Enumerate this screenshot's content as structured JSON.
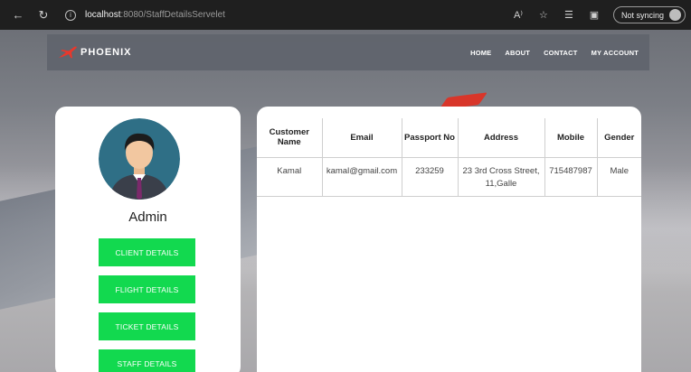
{
  "browser": {
    "url_host": "localhost",
    "url_path": ":8080/StaffDetailsServelet",
    "sync_label": "Not syncing",
    "read_aloud_icon": "A⁾"
  },
  "site": {
    "brand": "PHOENIX",
    "menu": [
      "HOME",
      "ABOUT",
      "CONTACT",
      "MY ACCOUNT"
    ]
  },
  "profile": {
    "role": "Admin",
    "buttons": [
      "CLIENT DETAILS",
      "FLIGHT DETAILS",
      "TICKET DETAILS",
      "STAFF DETAILS"
    ]
  },
  "table": {
    "headers": {
      "customer_name": "Customer Name",
      "email": "Email",
      "passport": "Passport No",
      "address": "Address",
      "mobile": "Mobile",
      "gender": "Gender"
    },
    "rows": [
      {
        "customer_name": "Kamal",
        "email": "kamal@gmail.com",
        "passport": "233259",
        "address": "23 3rd Cross Street, 11,Galle",
        "mobile": "715487987",
        "gender": "Male"
      }
    ]
  },
  "colors": {
    "accent_green": "#12d94f",
    "logo_red": "#e8382c",
    "navbar_bg": "#5f646c"
  }
}
